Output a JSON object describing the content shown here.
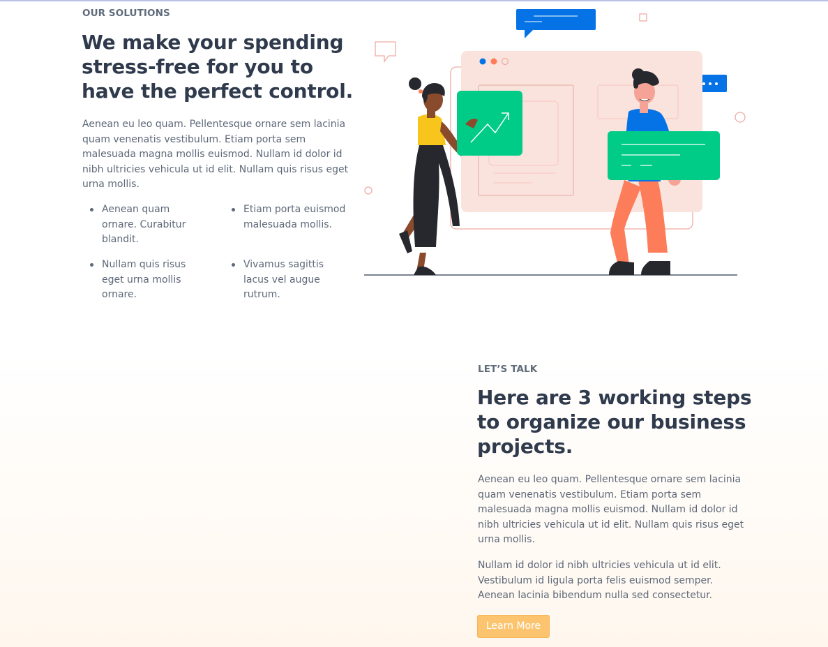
{
  "solutions": {
    "eyebrow": "OUR SOLUTIONS",
    "heading": "We make your spending stress-free for you to have the perfect control.",
    "paragraph": "Aenean eu leo quam. Pellentesque ornare sem lacinia quam venenatis vestibulum. Etiam porta sem malesuada magna mollis euismod. Nullam id dolor id nibh ultricies vehicula ut id elit. Nullam quis risus eget urna mollis.",
    "bullets": [
      "Aenean quam ornare. Curabitur blandit.",
      "Etiam porta euismod malesuada mollis.",
      "Nullam quis risus eget urna mollis ornare.",
      "Vivamus sagittis lacus vel augue rutrum."
    ],
    "illustration_icon": "people-with-charts-illustration"
  },
  "talk": {
    "eyebrow": "LET’S TALK",
    "heading": "Here are 3 working steps to organize our business projects.",
    "paragraph1": "Aenean eu leo quam. Pellentesque ornare sem lacinia quam venenatis vestibulum. Etiam porta sem malesuada magna mollis euismod. Nullam id dolor id nibh ultricies vehicula ut id elit. Nullam quis risus eget urna mollis.",
    "paragraph2": "Nullam id dolor id nibh ultricies vehicula ut id elit. Vestibulum id ligula porta felis euismod semper. Aenean lacinia bibendum nulla sed consectetur.",
    "button_label": "Learn More"
  },
  "colors": {
    "heading": "#2f3a4c",
    "body_text": "#5d6878",
    "accent_green": "#00cc88",
    "accent_blue": "#0573e6",
    "button": "#fdc46f"
  }
}
